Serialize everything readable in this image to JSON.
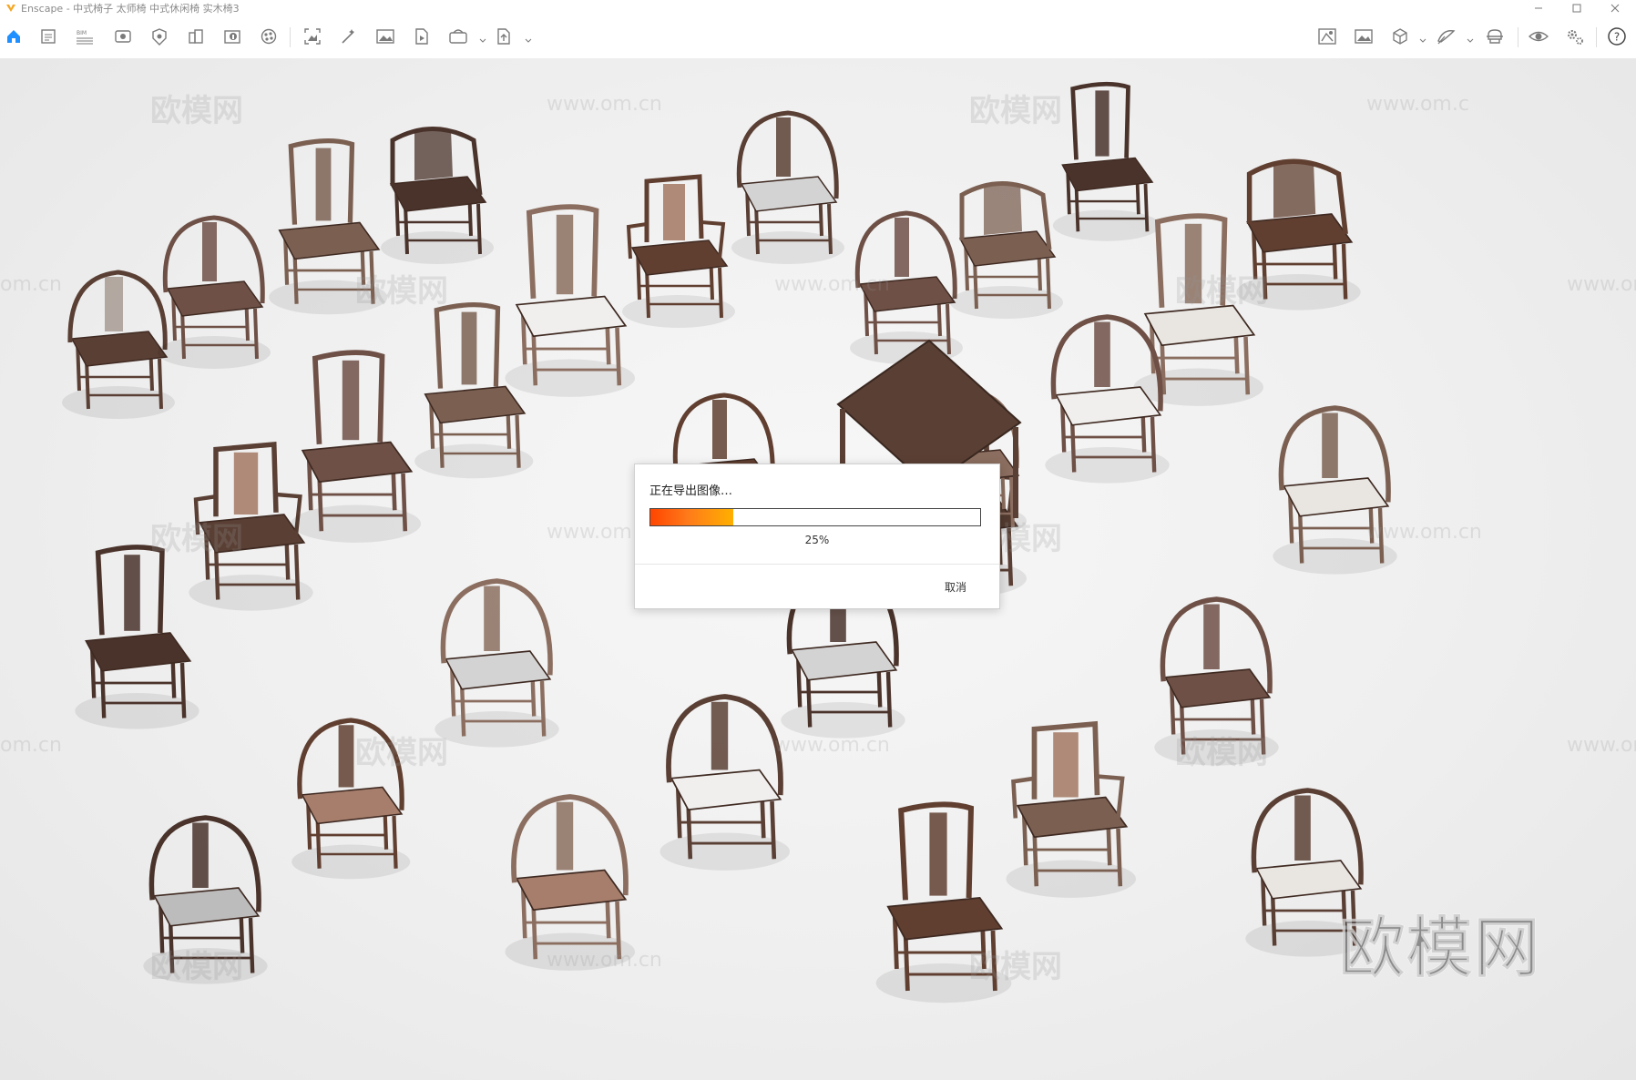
{
  "window": {
    "title": "Enscape - 中式椅子 太师椅 中式休闲椅 实木椅3",
    "controls": [
      "minimize-icon",
      "maximize-icon",
      "close-icon"
    ]
  },
  "toolbar": {
    "left_icons": [
      "home-icon",
      "views-icon",
      "bim-icon",
      "visual-settings-icon",
      "asset-library-icon",
      "building-icon",
      "info-icon",
      "material-icon",
      "screenshot-icon",
      "batch-render-icon",
      "panorama-icon",
      "video-icon",
      "export-icon",
      "upload-icon"
    ],
    "right_icons": [
      "map-icon",
      "image-icon",
      "cube-icon",
      "material-editor-icon",
      "vr-headset-icon",
      "visibility-icon",
      "settings-icon",
      "help-icon"
    ],
    "colors": {
      "icon": "#7a7a7a",
      "active": "#1e90ff"
    }
  },
  "watermarks": {
    "brand": "欧模网",
    "site": "www.om.cn",
    "site_partial": "om.cn",
    "site_partial2": "www.om.c"
  },
  "dialog": {
    "title": "正在导出图像…",
    "progress": 0.25,
    "progress_label": "25%",
    "cancel_label": "取消"
  },
  "scene": {
    "wood_colors": [
      "#5a3f34",
      "#6e5046",
      "#7b6052",
      "#4a332b",
      "#8b6e5f",
      "#603f30"
    ],
    "cushion_colors": [
      "#e9e6e2",
      "#d3d3d3",
      "#bcbcbc",
      "#a77e6c",
      "#f0efed"
    ]
  }
}
